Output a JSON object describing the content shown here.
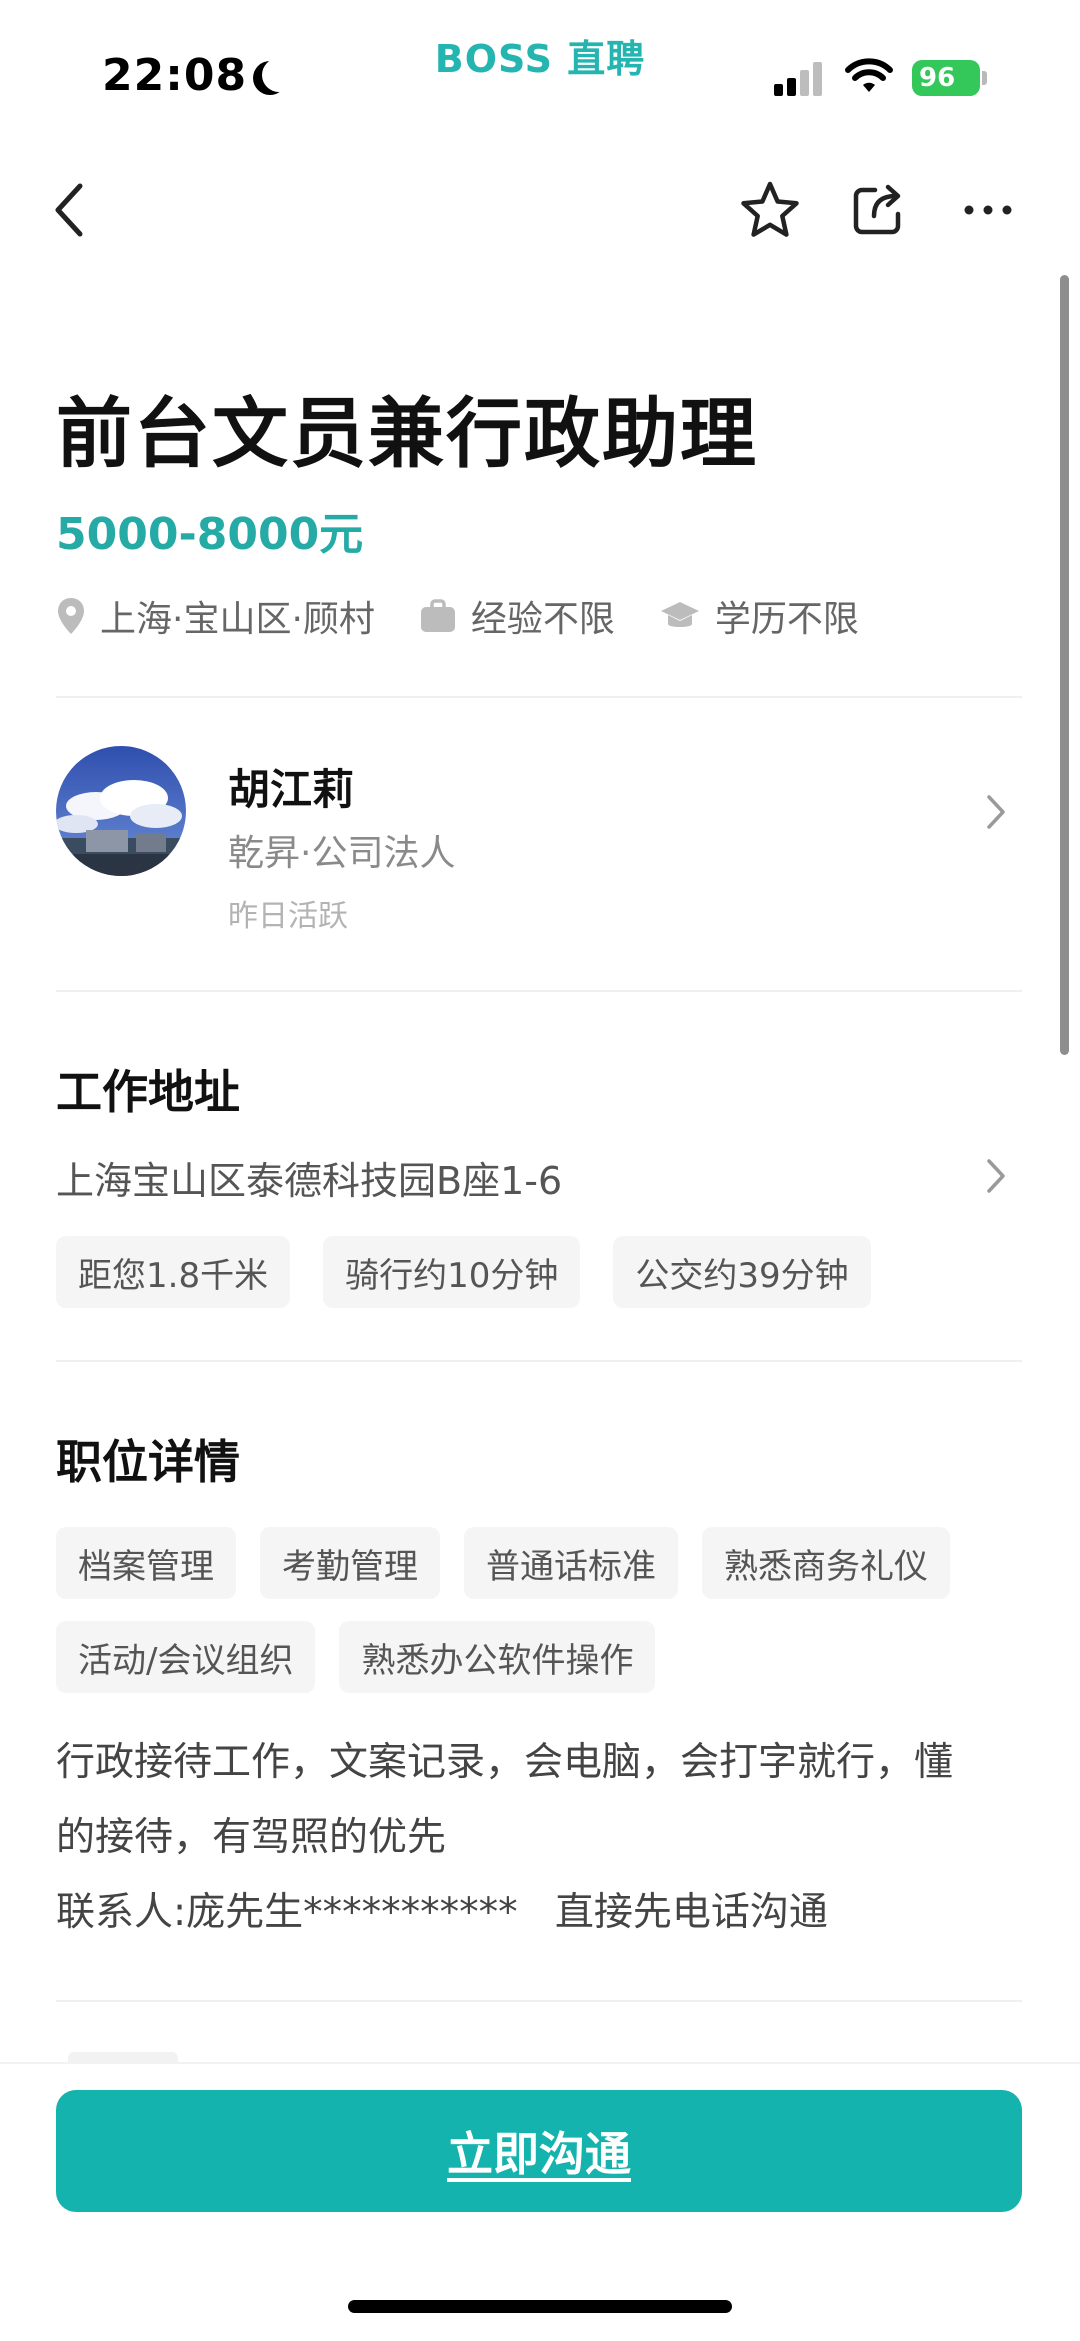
{
  "status_bar": {
    "time": "22:08",
    "brand": "BOSS 直聘",
    "battery": "96"
  },
  "job": {
    "title": "前台文员兼行政助理",
    "salary": "5000-8000元",
    "location": "上海·宝山区·顾村",
    "experience": "经验不限",
    "education": "学历不限"
  },
  "recruiter": {
    "name": "胡江莉",
    "role": "乾昇·公司法人",
    "active": "昨日活跃"
  },
  "work_address": {
    "heading": "工作地址",
    "address": "上海宝山区泰德科技园B座1-6",
    "tags": [
      "距您1.8千米",
      "骑行约10分钟",
      "公交约39分钟"
    ]
  },
  "job_details": {
    "heading": "职位详情",
    "tags_row1": [
      "档案管理",
      "考勤管理",
      "普通话标准",
      "熟悉商务礼仪"
    ],
    "tags_row2": [
      "活动/会议组织",
      "熟悉办公软件操作"
    ],
    "description": [
      "行政接待工作，文案记录，会电脑，会打字就行，懂",
      "的接待，有驾照的优先",
      "联系人:庞先生***********   直接先电话沟通"
    ]
  },
  "cta": {
    "label": "立即沟通"
  },
  "colors": {
    "accent": "#25aaa5",
    "button": "#15b3ad",
    "battery": "#34c759"
  }
}
